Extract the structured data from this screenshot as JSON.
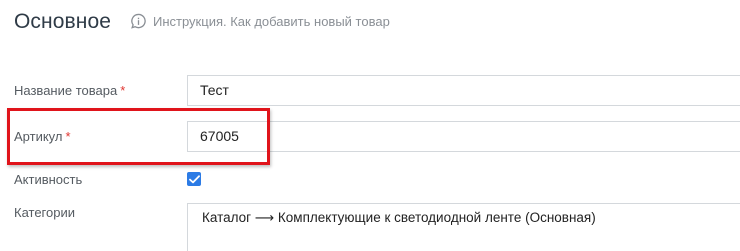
{
  "section": {
    "title": "Основное",
    "instruction_link": "Инструкция. Как добавить новый товар",
    "instruction_icon": "info-bubble-icon"
  },
  "form": {
    "name": {
      "label": "Название товара",
      "required_mark": "*",
      "value": "Тест"
    },
    "sku": {
      "label": "Артикул",
      "required_mark": "*",
      "value": "67005"
    },
    "active": {
      "label": "Активность",
      "checked": true
    },
    "categories": {
      "label": "Категории",
      "value": "Каталог ⟶ Комплектующие к светодиодной ленте (Основная)"
    }
  },
  "colors": {
    "highlight": "#e0141b",
    "checkbox": "#2c7be5",
    "required": "#e0342f"
  }
}
